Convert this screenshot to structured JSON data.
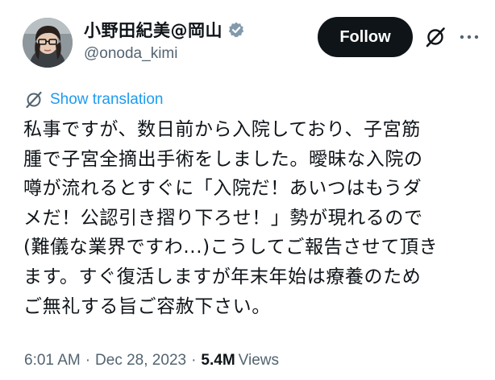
{
  "author": {
    "display_name": "小野田紀美@岡山",
    "handle": "@onoda_kimi",
    "verified": true
  },
  "actions": {
    "follow_label": "Follow",
    "grok_icon": "grok-slash-icon",
    "more_icon": "more-horizontal-icon"
  },
  "translation": {
    "label": "Show translation",
    "icon": "translate-icon"
  },
  "tweet": {
    "lines": [
      "私事ですが、数日前から入院しており、子宮筋",
      "腫で子宮全摘出手術をしました。曖昧な入院の",
      "噂が流れるとすぐに「入院だ！あいつはもうダ",
      "メだ！公認引き摺り下ろせ！」勢が現れるので",
      "(難儀な業界ですわ...)こうしてご報告させて頂き",
      "ます。すぐ復活しますが年末年始は療養のため",
      "ご無礼する旨ご容赦下さい。"
    ]
  },
  "meta": {
    "time": "6:01 AM",
    "date": "Dec 28, 2023",
    "separator": "·",
    "views_count": "5.4M",
    "views_label": "Views"
  },
  "colors": {
    "text": "#0f1419",
    "secondary": "#536471",
    "link": "#1d9bf0",
    "verified": "#829aab",
    "follow_bg": "#0f1419"
  }
}
